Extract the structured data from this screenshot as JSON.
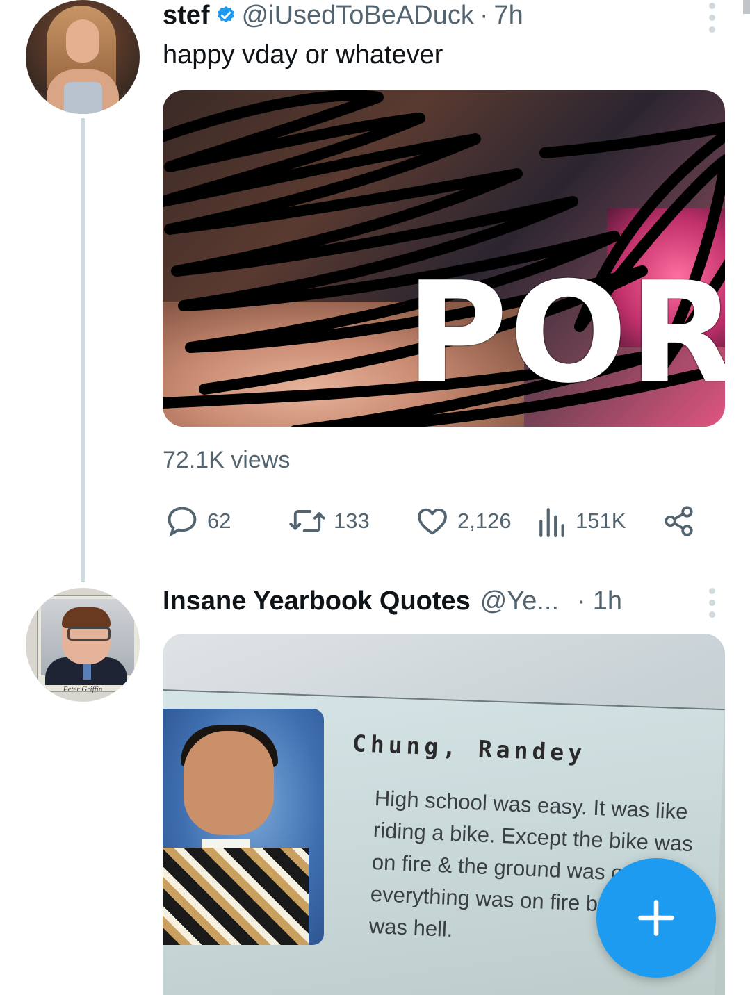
{
  "tweet1": {
    "name": "stef",
    "handle": "@iUsedToBeADuck",
    "separator": "·",
    "time": "7h",
    "text": "happy vday or whatever",
    "media_overlay": "PORN",
    "views": "72.1K views",
    "actions": {
      "reply": "62",
      "retweet": "133",
      "like": "2,126",
      "analytics": "151K"
    }
  },
  "tweet2": {
    "name": "Insane Yearbook Quotes",
    "handle": "@Ye...",
    "separator": "·",
    "time": "1h",
    "avatar_caption": "Peter Griffin",
    "yearbook_name": "Chung, Randey",
    "yearbook_quote": "High school was easy. It was like riding a bike. Except the bike was on fire & the ground was on fire & everything was on fire because it was hell."
  },
  "icons": {
    "verified": "verified-badge-icon",
    "more": "more-vertical-icon",
    "reply": "reply-bubble-icon",
    "retweet": "retweet-icon",
    "like": "heart-icon",
    "analytics": "analytics-bars-icon",
    "share": "share-icon",
    "mute": "speaker-muted-icon",
    "compose": "plus-icon"
  },
  "colors": {
    "accent": "#1d9bf0",
    "secondary_text": "#536471",
    "thread_line": "#cfd9de"
  }
}
